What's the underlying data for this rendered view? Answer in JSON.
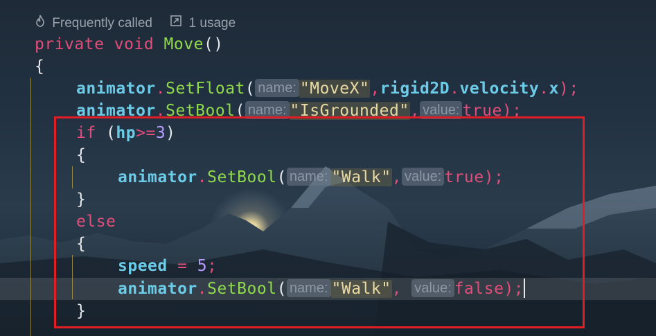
{
  "codelens": {
    "frequency_icon": "flame-icon",
    "frequency_label": "Frequently called",
    "usage_icon": "external-link-icon",
    "usage_label": "1 usage"
  },
  "colors": {
    "keyword": "#e24d7a",
    "method": "#8fd94a",
    "identifier": "#6ccbe6",
    "number": "#b99cff",
    "string": "#e8d9a2",
    "highlight_box": "#e21d24",
    "indent_guide": "#b9a64a"
  },
  "code": {
    "l1": {
      "kw1": "private",
      "kw2": "void",
      "name": "Move",
      "paren": "()"
    },
    "l2": {
      "brace": "{"
    },
    "l3": {
      "obj": "animator",
      "dot": ".",
      "method": "SetFloat",
      "open": "(",
      "hint": "name:",
      "arg1": "\"MoveX\"",
      "comma": ",",
      "arg2a": "rigid2D",
      "dot2": ".",
      "arg2b": "velocity",
      "dot3": ".",
      "arg2c": "x",
      "close": ");"
    },
    "l4": {
      "obj": "animator",
      "dot": ".",
      "method": "SetBool",
      "open": "(",
      "hint1": "name:",
      "arg1": "\"IsGrounded\"",
      "comma": ",",
      "hint2": "value:",
      "arg2": "true",
      "close": ");"
    },
    "l5": {
      "kw": "if",
      "open": " (",
      "var": "hp",
      "op": ">=",
      "num": "3",
      "close": ")"
    },
    "l6": {
      "brace": "{"
    },
    "l7": {
      "obj": "animator",
      "dot": ".",
      "method": "SetBool",
      "open": "(",
      "hint1": "name:",
      "arg1": "\"Walk\"",
      "comma": ",",
      "hint2": "value:",
      "arg2": "true",
      "close": ");"
    },
    "l8": {
      "brace": "}"
    },
    "l9": {
      "kw": "else"
    },
    "l10": {
      "brace": "{"
    },
    "l11": {
      "var": "speed",
      "op": " = ",
      "num": "5",
      "semi": ";"
    },
    "l12": {
      "obj": "animator",
      "dot": ".",
      "method": "SetBool",
      "open": "(",
      "hint1": "name:",
      "arg1": "\"Walk\"",
      "comma": ", ",
      "hint2": "value:",
      "arg2": "false",
      "close": ");"
    },
    "l13": {
      "brace": "}"
    }
  }
}
